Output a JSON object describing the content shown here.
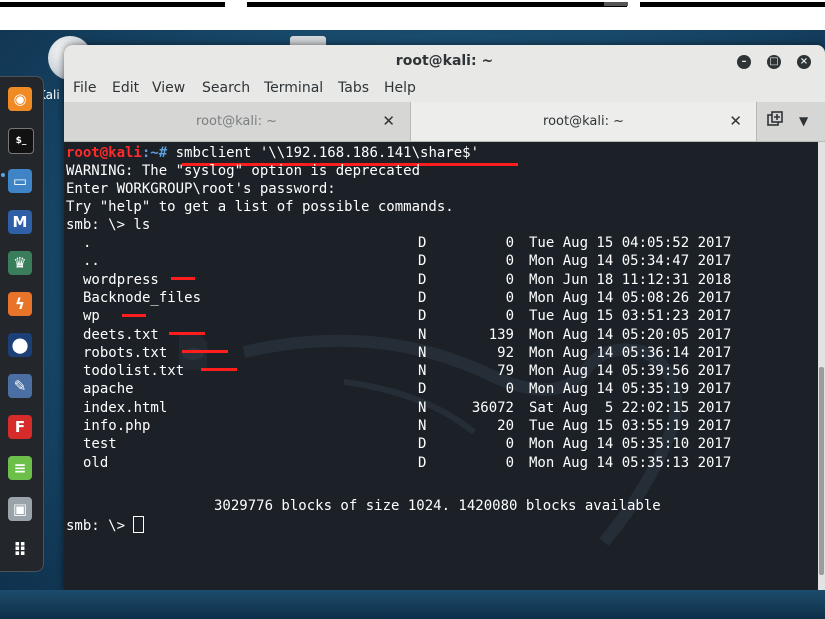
{
  "desktop": {
    "icon_label": "Kali"
  },
  "dock": {
    "items": [
      {
        "name": "firefox-icon",
        "glyph": "◉",
        "bg": "#f08a24"
      },
      {
        "name": "terminal-icon",
        "glyph": "$_",
        "bg": "#111111"
      },
      {
        "name": "files-icon",
        "glyph": "▭",
        "bg": "#3f84c6"
      },
      {
        "name": "metasploit-icon",
        "glyph": "M",
        "bg": "#2f5fa7"
      },
      {
        "name": "armitage-icon",
        "glyph": "♛",
        "bg": "#3a7d5a"
      },
      {
        "name": "burpsuite-icon",
        "glyph": "ϟ",
        "bg": "#e8742a"
      },
      {
        "name": "maltego-icon",
        "glyph": "⬤",
        "bg": "#1c3f77"
      },
      {
        "name": "beef-icon",
        "glyph": "✎",
        "bg": "#4b6fa3"
      },
      {
        "name": "faraday-icon",
        "glyph": "F",
        "bg": "#d62b2b"
      },
      {
        "name": "leafpad-icon",
        "glyph": "≡",
        "bg": "#6cc04a"
      },
      {
        "name": "screenshot-icon",
        "glyph": "▣",
        "bg": "#9aa3aa"
      },
      {
        "name": "show-apps-icon",
        "glyph": "⠿",
        "bg": "#23272c"
      }
    ]
  },
  "window": {
    "title": "root@kali: ~"
  },
  "menu": [
    "File",
    "Edit",
    "View",
    "Search",
    "Terminal",
    "Tabs",
    "Help"
  ],
  "tabs": [
    {
      "label": "root@kali: ~",
      "active": false
    },
    {
      "label": "root@kali: ~",
      "active": true
    }
  ],
  "terminal": {
    "prompt_user": "root@kali",
    "prompt_path": ":~#",
    "command": " smbclient '\\\\192.168.186.141\\share$'",
    "lines": [
      "WARNING: The \"syslog\" option is deprecated",
      "Enter WORKGROUP\\root's password:",
      "Try \"help\" to get a list of possible commands.",
      "smb: \\> ls"
    ],
    "listing": [
      {
        "name": ".",
        "type": "D",
        "size": "0",
        "date": "Tue Aug 15 04:05:52 2017"
      },
      {
        "name": "..",
        "type": "D",
        "size": "0",
        "date": "Mon Aug 14 05:34:47 2017"
      },
      {
        "name": "wordpress",
        "type": "D",
        "size": "0",
        "date": "Mon Jun 18 11:12:31 2018"
      },
      {
        "name": "Backnode_files",
        "type": "D",
        "size": "0",
        "date": "Mon Aug 14 05:08:26 2017"
      },
      {
        "name": "wp",
        "type": "D",
        "size": "0",
        "date": "Tue Aug 15 03:51:23 2017"
      },
      {
        "name": "deets.txt",
        "type": "N",
        "size": "139",
        "date": "Mon Aug 14 05:20:05 2017"
      },
      {
        "name": "robots.txt",
        "type": "N",
        "size": "92",
        "date": "Mon Aug 14 05:36:14 2017"
      },
      {
        "name": "todolist.txt",
        "type": "N",
        "size": "79",
        "date": "Mon Aug 14 05:39:56 2017"
      },
      {
        "name": "apache",
        "type": "D",
        "size": "0",
        "date": "Mon Aug 14 05:35:19 2017"
      },
      {
        "name": "index.html",
        "type": "N",
        "size": "36072",
        "date": "Sat Aug  5 22:02:15 2017"
      },
      {
        "name": "info.php",
        "type": "N",
        "size": "20",
        "date": "Tue Aug 15 03:55:19 2017"
      },
      {
        "name": "test",
        "type": "D",
        "size": "0",
        "date": "Mon Aug 14 05:35:10 2017"
      },
      {
        "name": "old",
        "type": "D",
        "size": "0",
        "date": "Mon Aug 14 05:35:13 2017"
      }
    ],
    "blocks_line": "3029776 blocks of size 1024. 1420080 blocks available",
    "final_prompt": "smb: \\> "
  }
}
